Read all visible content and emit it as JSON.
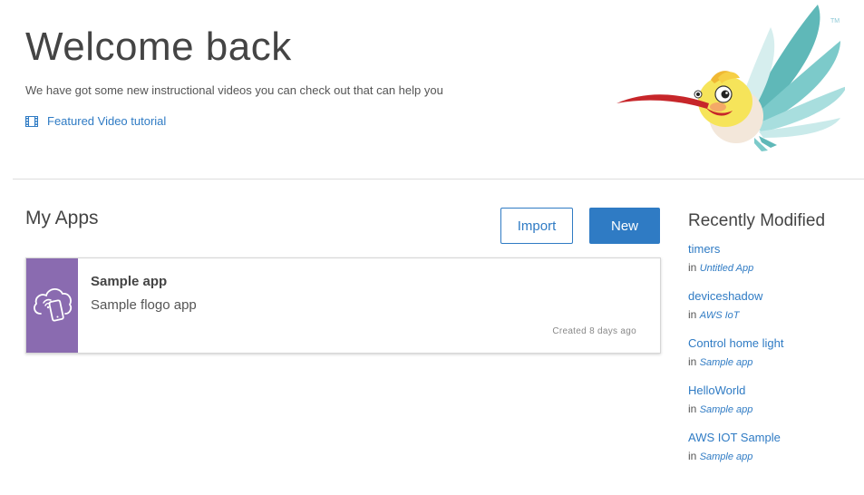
{
  "welcome": {
    "title": "Welcome back",
    "subtitle": "We have got some new instructional videos you can check out that can help you",
    "video_link": "Featured Video tutorial",
    "trademark": "TM"
  },
  "my_apps": {
    "title": "My Apps",
    "import_label": "Import",
    "new_label": "New",
    "apps": [
      {
        "name": "Sample app",
        "description": "Sample flogo app",
        "created": "Created 8 days ago",
        "icon": "cloud-mobile-icon",
        "icon_color": "#8a6bb0"
      }
    ]
  },
  "recent": {
    "title": "Recently Modified",
    "in_label": "in",
    "items": [
      {
        "name": "timers",
        "app": "Untitled App"
      },
      {
        "name": "deviceshadow",
        "app": "AWS IoT"
      },
      {
        "name": "Control home light",
        "app": "Sample app"
      },
      {
        "name": "HelloWorld",
        "app": "Sample app"
      },
      {
        "name": "AWS IOT Sample",
        "app": "Sample app"
      }
    ]
  },
  "colors": {
    "accent": "#2f7bc4",
    "app_tile": "#8a6bb0",
    "divider": "#dddddd"
  }
}
